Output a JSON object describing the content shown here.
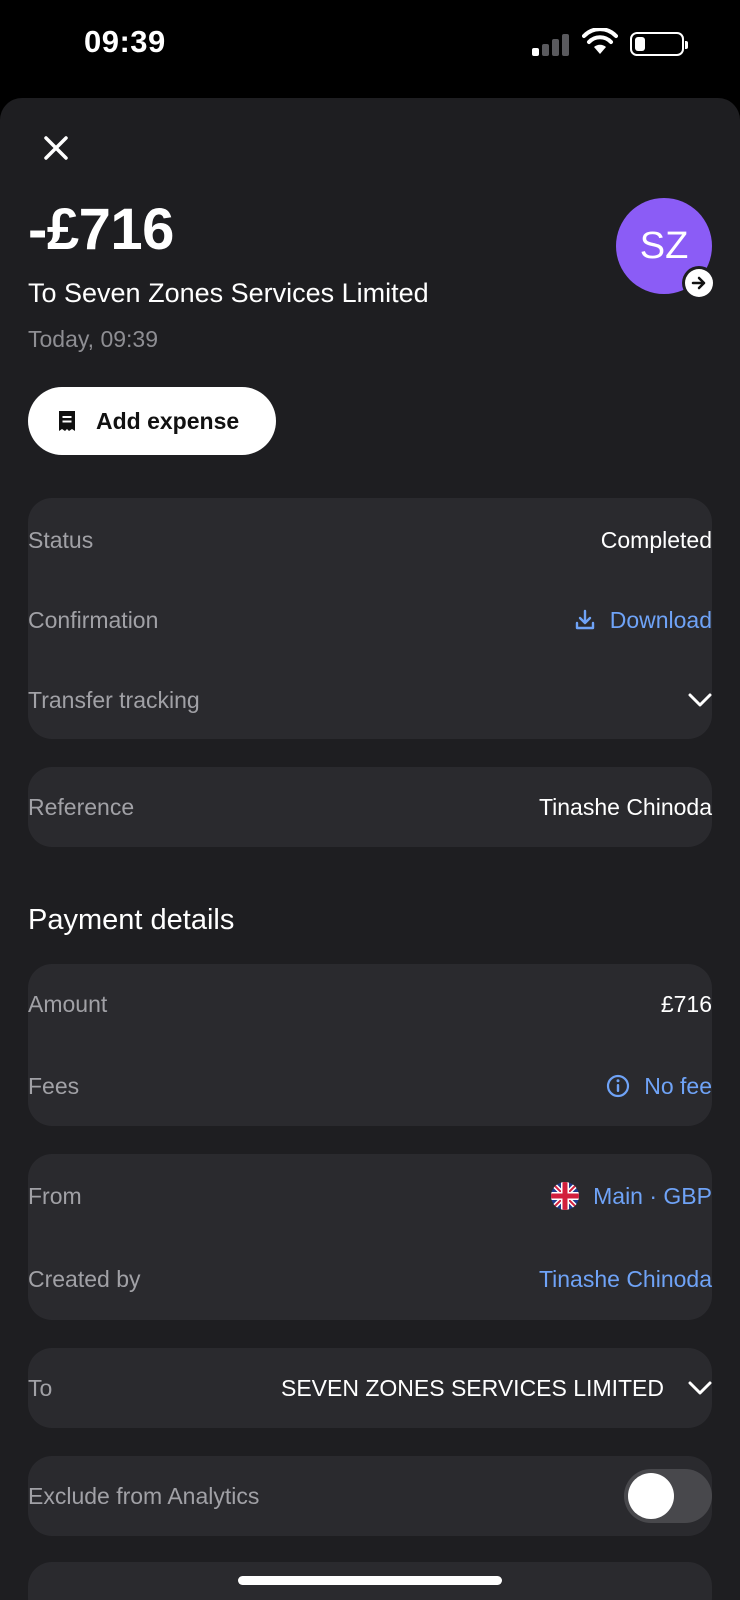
{
  "status_bar": {
    "time": "09:39"
  },
  "header": {
    "amount": "-£716",
    "recipient": "To Seven Zones Services Limited",
    "date": "Today, 09:39",
    "avatar_initials": "SZ",
    "avatar_color": "#8b5cf6"
  },
  "actions": {
    "add_expense_label": "Add expense"
  },
  "summary": {
    "status_label": "Status",
    "status_value": "Completed",
    "confirmation_label": "Confirmation",
    "confirmation_value": "Download",
    "tracking_label": "Transfer tracking"
  },
  "reference": {
    "label": "Reference",
    "value": "Tinashe Chinoda"
  },
  "payment_details": {
    "title": "Payment details",
    "amount_label": "Amount",
    "amount_value": "£716",
    "fees_label": "Fees",
    "fees_value": "No fee"
  },
  "source": {
    "from_label": "From",
    "from_value": "Main · GBP",
    "created_by_label": "Created by",
    "created_by_value": "Tinashe Chinoda"
  },
  "destination": {
    "to_label": "To",
    "to_value": "SEVEN ZONES SERVICES LIMITED"
  },
  "analytics": {
    "exclude_label": "Exclude from Analytics",
    "exclude_enabled": false
  },
  "colors": {
    "accent_link": "#6fa3f7",
    "card_bg": "#2a2a2e",
    "sheet_bg": "#1e1e21"
  }
}
